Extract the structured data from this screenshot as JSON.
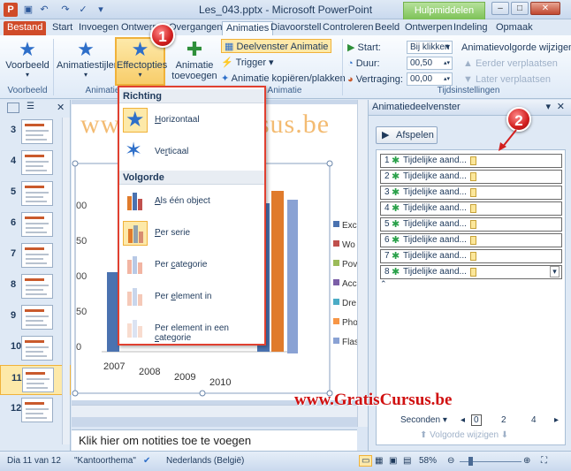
{
  "titlebar": {
    "title": "Les_043.pptx - Microsoft PowerPoint",
    "context_tools": "Hulpmiddelen vo...",
    "minimize": "–",
    "maximize": "□",
    "close": "✕"
  },
  "tabs": [
    "Bestand",
    "Start",
    "Invoegen",
    "Ontwerp",
    "Overgangen",
    "Animaties",
    "Diavoorstell",
    "Controleren",
    "Beeld",
    "Ontwerpen",
    "Indeling",
    "Opmaak"
  ],
  "ribbon": {
    "preview_label": "Voorbeeld",
    "preview_group": "Voorbeeld",
    "animation_styles": "Animatiestijlen",
    "effect_options": "Effectopties",
    "add_animation": "Animatie toevoegen",
    "animation_group": "Animatie",
    "anim_pane_btn": "Deelvenster Animatie",
    "trigger": "Trigger",
    "copy_anim": "Animatie kopiëren/plakken",
    "start_label": "Start:",
    "start_value": "Bij klikken",
    "duration_label": "Duur:",
    "duration_value": "00,50",
    "delay_label": "Vertraging:",
    "delay_value": "00,00",
    "reorder_title": "Animatievolgorde wijzigen",
    "move_earlier": "Eerder verplaatsen",
    "move_later": "Later verplaatsen",
    "timing_group": "Tijdsinstellingen"
  },
  "dropdown": {
    "section1": "Richting",
    "horizontal_u": "H",
    "horizontal_rest": "orizontaal",
    "vertical_pre": "Ve",
    "vertical_u": "r",
    "vertical_rest": "ticaal",
    "section2": "Volgorde",
    "as_one_u": "A",
    "as_one_rest": "ls één object",
    "by_series_u": "P",
    "by_series_rest": "er serie",
    "by_category_pre": "Per ",
    "by_category_u": "c",
    "by_category_rest": "ategorie",
    "by_element_pre": "Per ",
    "by_element_u": "e",
    "by_element_rest": "lement in",
    "by_element_cat_pre": "Per element in een ",
    "by_element_cat_u": "c",
    "by_element_cat_rest": "ategorie"
  },
  "slides": {
    "numbers": [
      "3",
      "4",
      "5",
      "6",
      "7",
      "8",
      "9",
      "10",
      "11",
      "12"
    ],
    "selected": "11"
  },
  "slide": {
    "title": "www.GratisCursus.be",
    "legend": [
      "Exc",
      "Wo",
      "Pov",
      "Acc",
      "Dre",
      "Pho",
      "Flas"
    ],
    "legend_colors": [
      "#4a72b0",
      "#c0504d",
      "#9bbb59",
      "#7b5ea7",
      "#4bacc6",
      "#f79646",
      "#8aa2d4"
    ],
    "years": [
      "2007",
      "2008",
      "2009",
      "2010"
    ],
    "y_ticks": [
      "00",
      "50",
      "00",
      "50",
      "0"
    ]
  },
  "notes": {
    "placeholder": "Klik hier om notities toe te voegen"
  },
  "anim_pane": {
    "title": "Animatiedeelvenster",
    "play": "Afspelen",
    "items": [
      {
        "num": "1",
        "label": "Tijdelijke aand..."
      },
      {
        "num": "2",
        "label": "Tijdelijke aand..."
      },
      {
        "num": "3",
        "label": "Tijdelijke aand..."
      },
      {
        "num": "4",
        "label": "Tijdelijke aand..."
      },
      {
        "num": "5",
        "label": "Tijdelijke aand..."
      },
      {
        "num": "6",
        "label": "Tijdelijke aand..."
      },
      {
        "num": "7",
        "label": "Tijdelijke aand..."
      },
      {
        "num": "8",
        "label": "Tijdelijke aand..."
      }
    ],
    "seconds": "Seconden",
    "ticks": [
      "0",
      "2",
      "4"
    ],
    "reorder": "Volgorde wijzigen"
  },
  "watermark": "www.GratisCursus.be",
  "badges": [
    "1",
    "2"
  ],
  "statusbar": {
    "slide_info": "Dia 11 van 12",
    "theme": "\"Kantoorthema\"",
    "language": "Nederlands (België)",
    "zoom": "58%"
  }
}
